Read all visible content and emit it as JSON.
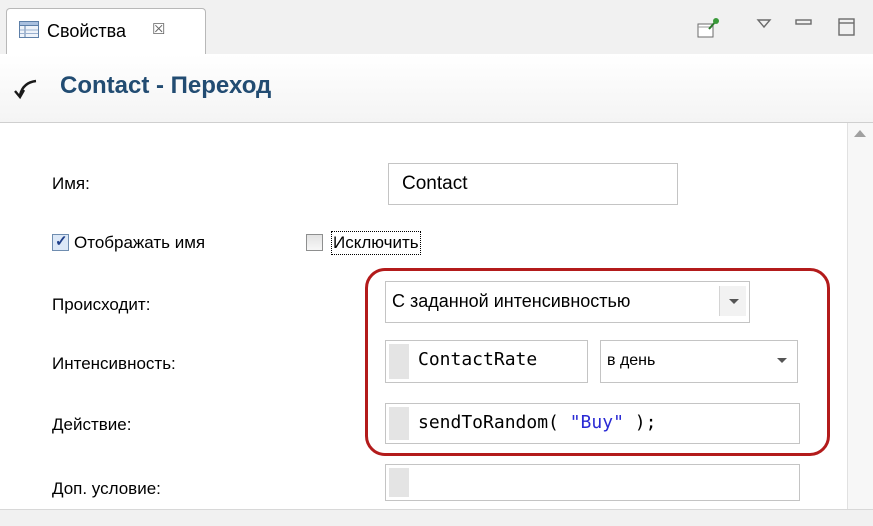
{
  "tab": {
    "label": "Свойства",
    "close_glyph": "☒"
  },
  "view_toolbar": {
    "icons": [
      "pin-icon",
      "view-menu-icon",
      "minimize-icon",
      "maximize-icon"
    ]
  },
  "header": {
    "title": "Contact - Переход",
    "icon": "transition-icon"
  },
  "form": {
    "name": {
      "label": "Имя:",
      "value": "Contact"
    },
    "show_name": {
      "label": "Отображать имя",
      "checked": true
    },
    "exclude": {
      "label": "Исключить",
      "checked": false
    },
    "triggered_by": {
      "label": "Происходит:",
      "value": "С заданной интенсивностью"
    },
    "rate": {
      "label": "Интенсивность:",
      "value": "ContactRate",
      "unit": "в день"
    },
    "action": {
      "label": "Действие:",
      "code_prefix": "sendToRandom( ",
      "code_string": "\"Buy\"",
      "code_suffix": " );"
    },
    "guard": {
      "label": "Доп. условие:",
      "value": ""
    }
  },
  "colors": {
    "title": "#224c72",
    "highlight": "#b31b1b",
    "string_literal": "#2a2ad4"
  }
}
